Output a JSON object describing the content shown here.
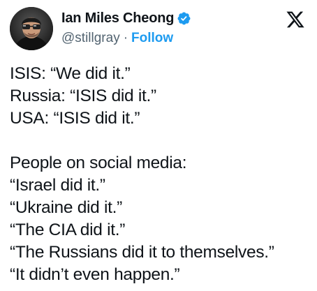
{
  "tweet": {
    "author": {
      "display_name": "Ian Miles Cheong",
      "handle": "@stillgray",
      "separator": "·",
      "follow_label": "Follow",
      "verified": true,
      "verified_color": "#1d9bf0",
      "avatar_icon": "avatar-photo"
    },
    "platform_icon": "x-logo-icon",
    "lines": [
      "ISIS: “We did it.”",
      "Russia: “ISIS did it.”",
      "USA: “ISIS did it.”",
      "",
      "People on social media:",
      "“Israel did it.”",
      "“Ukraine did it.”",
      "“The CIA did it.”",
      "“The Russians did it to themselves.”",
      "“It didn’t even happen.”"
    ]
  },
  "colors": {
    "text": "#0f1419",
    "secondary": "#536471",
    "accent": "#1d9bf0"
  }
}
